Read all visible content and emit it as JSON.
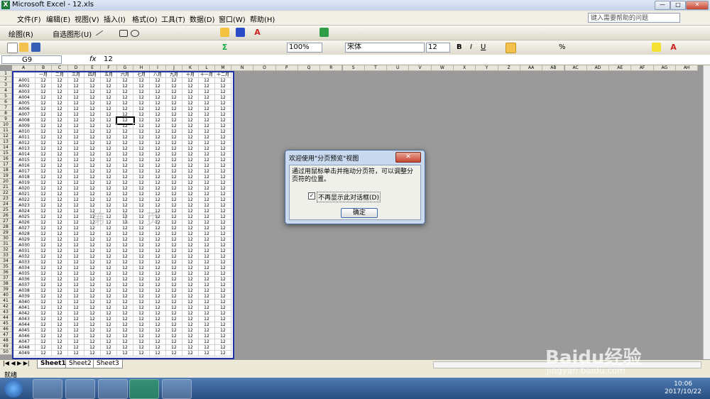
{
  "window": {
    "title": "Microsoft Excel - 12.xls"
  },
  "menu": {
    "items": [
      "文件(F)",
      "编辑(E)",
      "视图(V)",
      "插入(I)",
      "格式(O)",
      "工具(T)",
      "数据(D)",
      "窗口(W)",
      "帮助(H)"
    ],
    "help_placeholder": "键入需要帮助的问题"
  },
  "drawing_toolbar": {
    "draw_label": "绘图(R)",
    "autoshape_label": "自选图形(U)"
  },
  "format_toolbar": {
    "zoom": "100%",
    "font": "宋体",
    "font_size": "12",
    "bold": "B",
    "italic": "I",
    "underline": "U",
    "percent": "%"
  },
  "formula_bar": {
    "cell_ref": "G9",
    "fx": "fx",
    "value": "12"
  },
  "columns": [
    "A",
    "B",
    "C",
    "D",
    "E",
    "F",
    "G",
    "H",
    "I",
    "J",
    "K",
    "L",
    "M",
    "N",
    "O",
    "P",
    "Q",
    "R",
    "S",
    "T",
    "U",
    "V",
    "W",
    "X",
    "Y",
    "Z",
    "AA",
    "AB",
    "AC",
    "AD",
    "AE",
    "AF",
    "AG",
    "AH"
  ],
  "header_row": [
    "",
    "一月",
    "二月",
    "三月",
    "四月",
    "五月",
    "六月",
    "七月",
    "八月",
    "九月",
    "十月",
    "十一月",
    "十二月"
  ],
  "row_labels_prefix": "A0",
  "cell_value": "12",
  "row_count": 50,
  "watermark": "第 1 页",
  "dialog": {
    "title": "欢迎使用\"分页预览\"视图",
    "message": "通过用鼠标单击并拖动分页符，可以调整分页符的位置。",
    "checkbox_label": "不再显示此对话框(D)",
    "checkbox_checked": true,
    "ok_label": "确定",
    "close_label": "✕"
  },
  "sheet_tabs": [
    "Sheet1",
    "Sheet2",
    "Sheet3"
  ],
  "status": {
    "text": "就绪"
  },
  "clock": {
    "time": "10:06",
    "date": "2017/10/22"
  },
  "brand_watermark": "Baidu经验",
  "brand_url": "jingyan.baidu.com"
}
